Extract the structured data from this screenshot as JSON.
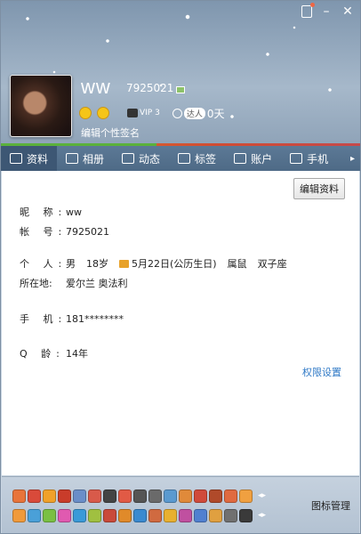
{
  "window": {
    "controls": [
      "skin",
      "minimize",
      "close"
    ],
    "minimize_label": "–",
    "close_label": "✕"
  },
  "profile": {
    "nickname": "ww",
    "qq_number": "7925021",
    "signature_placeholder": "编辑个性签名",
    "vip_label": "VIP 3",
    "online_label": "达人",
    "online_days": "0天"
  },
  "tabs": [
    {
      "label": "资料",
      "icon": "id-card-icon",
      "active": true
    },
    {
      "label": "相册",
      "icon": "photo-icon",
      "active": false
    },
    {
      "label": "动态",
      "icon": "feed-icon",
      "active": false
    },
    {
      "label": "标签",
      "icon": "tag-icon",
      "active": false
    },
    {
      "label": "账户",
      "icon": "wallet-icon",
      "active": false
    },
    {
      "label": "手机",
      "icon": "phone-icon",
      "active": false
    }
  ],
  "tabs_more": "▸",
  "content": {
    "edit_button": "编辑资料",
    "nickname_label": "昵  称:",
    "nickname_value": "ww",
    "account_label": "帐  号:",
    "account_value": "7925021",
    "personal_label": "个  人:",
    "gender": "男",
    "age": "18岁",
    "birthday": "5月22日(公历生日)",
    "zodiac": "属鼠",
    "constellation": "双子座",
    "location_label": "所在地:",
    "location_value": "爱尔兰 奥法利",
    "phone_label": "手  机:",
    "phone_value": "181********",
    "qage_label": "Q  龄:",
    "qage_value": "14年",
    "permission_link": "权限设置"
  },
  "footer": {
    "icon_manage": "图标管理",
    "row_arrows": "◂▸",
    "icon_colors_row1": [
      "#e8743a",
      "#d94a3a",
      "#f0a12a",
      "#c93c2a",
      "#6a8ec9",
      "#d85a4a",
      "#444",
      "#e15a45",
      "#555",
      "#6a6a6a",
      "#5a9ad0",
      "#e08a3a",
      "#d04a3a",
      "#b04a2a",
      "#e06a40",
      "#f0a040"
    ],
    "icon_colors_row2": [
      "#f09a3a",
      "#4aa0d8",
      "#7ac043",
      "#e05ab0",
      "#3a9ad8",
      "#a0c040",
      "#c94a3a",
      "#e08a2a",
      "#3a8ad0",
      "#d06a40",
      "#e8b030",
      "#c050a0",
      "#5080d0",
      "#e0a040",
      "#707070",
      "#3a3a3a"
    ]
  }
}
